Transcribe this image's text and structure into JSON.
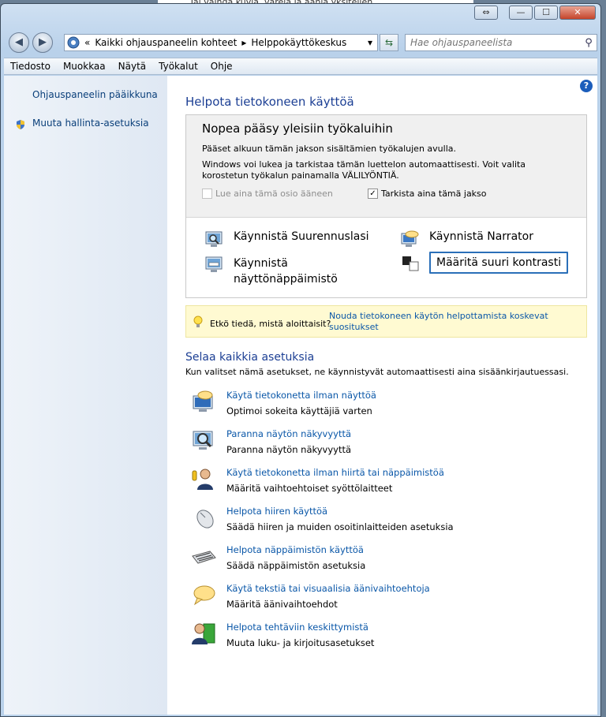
{
  "background_window_text": "Tai vaihda kuvia, värejä ja ääniä yksitellen",
  "window_buttons": {
    "nav": "⇔",
    "minimize": "—",
    "maximize": "☐",
    "close": "✕"
  },
  "address": {
    "root_glyph": "«",
    "crumbs": [
      "Kaikki ohjauspaneelin kohteet",
      "Helppokäyttökeskus"
    ],
    "separator": "▸",
    "dropdown": "▾"
  },
  "search": {
    "placeholder": "Hae ohjauspaneelista"
  },
  "menu": [
    "Tiedosto",
    "Muokkaa",
    "Näytä",
    "Työkalut",
    "Ohje"
  ],
  "sidebar": {
    "home": "Ohjauspaneelin pääikkuna",
    "admin": "Muuta hallinta-asetuksia"
  },
  "page": {
    "title": "Helpota tietokoneen käyttöä",
    "help": "?",
    "quick": {
      "title": "Nopea pääsy yleisiin työkaluihin",
      "line1": "Pääset alkuun tämän jakson sisältämien työkalujen avulla.",
      "line2": "Windows voi lukea ja tarkistaa tämän luettelon automaattisesti. Voit valita korostetun työkalun painamalla VÄLILYÖNTIÄ.",
      "check_read": "Lue aina tämä osio ääneen",
      "check_scan": "Tarkista aina tämä jakso",
      "check_scan_mark": "✓",
      "tool_magnifier": "Käynnistä Suurennuslasi",
      "tool_narrator": "Käynnistä Narrator",
      "tool_keyboard": "Käynnistä näyttönäppäimistö",
      "tool_contrast": "Määritä suuri kontrasti"
    },
    "tip": {
      "question": "Etkö tiedä, mistä aloittaisit?",
      "link": "Nouda tietokoneen käytön helpottamista koskevat suositukset"
    },
    "browse": {
      "title": "Selaa kaikkia asetuksia",
      "desc": "Kun valitset nämä asetukset, ne käynnistyvät automaattisesti aina sisäänkirjautuessasi."
    },
    "options": [
      {
        "icon": "monitor-speech-icon",
        "title": "Käytä tietokonetta ilman näyttöä",
        "desc": "Optimoi sokeita käyttäjiä varten"
      },
      {
        "icon": "monitor-magnifier-icon",
        "title": "Paranna näytön näkyvyyttä",
        "desc": "Paranna näytön näkyvyyttä"
      },
      {
        "icon": "user-input-icon",
        "title": "Käytä tietokonetta ilman hiirtä tai näppäimistöä",
        "desc": "Määritä vaihtoehtoiset syöttölaitteet"
      },
      {
        "icon": "mouse-icon",
        "title": "Helpota hiiren käyttöä",
        "desc": "Säädä hiiren ja muiden osoitinlaitteiden asetuksia"
      },
      {
        "icon": "keyboard-icon",
        "title": "Helpota näppäimistön käyttöä",
        "desc": "Säädä näppäimistön asetuksia"
      },
      {
        "icon": "speech-bubble-icon",
        "title": "Käytä tekstiä tai visuaalisia äänivaihtoehtoja",
        "desc": "Määritä äänivaihtoehdot"
      },
      {
        "icon": "reading-user-icon",
        "title": "Helpota tehtäviin keskittymistä",
        "desc": "Muuta luku- ja kirjoitusasetukset"
      }
    ]
  }
}
